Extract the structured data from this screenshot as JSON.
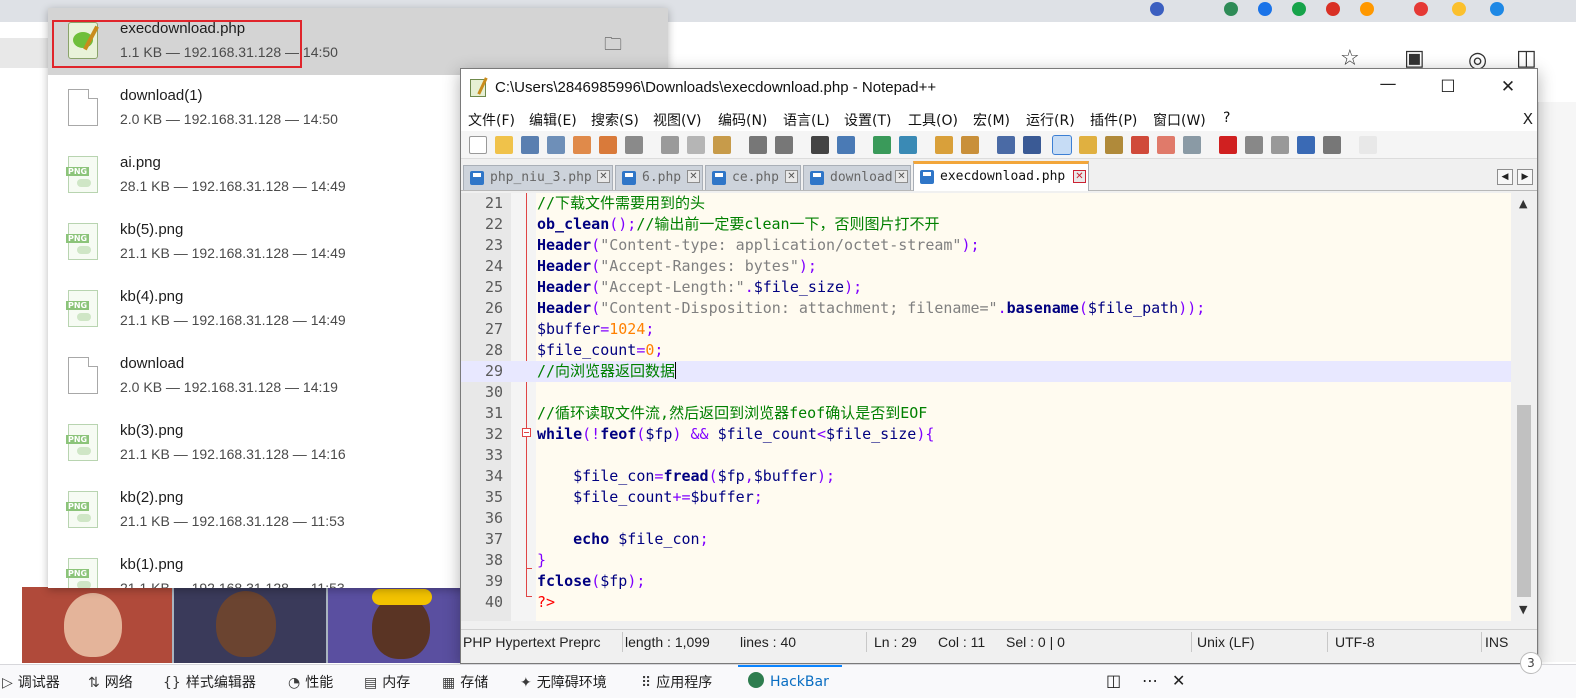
{
  "downloads": {
    "items": [
      {
        "name": "execdownload.php",
        "meta": "1.1 KB — 192.168.31.128 — 14:50",
        "type": "php"
      },
      {
        "name": "download(1)",
        "meta": "2.0 KB — 192.168.31.128 — 14:50",
        "type": "doc"
      },
      {
        "name": "ai.png",
        "meta": "28.1 KB — 192.168.31.128 — 14:49",
        "type": "png"
      },
      {
        "name": "kb(5).png",
        "meta": "21.1 KB — 192.168.31.128 — 14:49",
        "type": "png"
      },
      {
        "name": "kb(4).png",
        "meta": "21.1 KB — 192.168.31.128 — 14:49",
        "type": "png"
      },
      {
        "name": "download",
        "meta": "2.0 KB — 192.168.31.128 — 14:19",
        "type": "doc"
      },
      {
        "name": "kb(3).png",
        "meta": "21.1 KB — 192.168.31.128 — 14:16",
        "type": "png"
      },
      {
        "name": "kb(2).png",
        "meta": "21.1 KB — 192.168.31.128 — 11:53",
        "type": "png"
      },
      {
        "name": "kb(1).png",
        "meta": "21.1 KB — 192.168.31.128 — 11:53",
        "type": "png"
      }
    ],
    "png_tag": "PNG"
  },
  "notepad": {
    "title": "C:\\Users\\2846985996\\Downloads\\execdownload.php - Notepad++",
    "menu": [
      "文件(F)",
      "编辑(E)",
      "搜索(S)",
      "视图(V)",
      "编码(N)",
      "语言(L)",
      "设置(T)",
      "工具(O)",
      "宏(M)",
      "运行(R)",
      "插件(P)",
      "窗口(W)",
      "?"
    ],
    "menu_close": "X",
    "tabs": [
      "php_niu_3.php",
      "6.php",
      "ce.php",
      "download",
      "execdownload.php"
    ],
    "active_tab": "execdownload.php",
    "line_numbers": [
      "21",
      "22",
      "23",
      "24",
      "25",
      "26",
      "27",
      "28",
      "29",
      "30",
      "31",
      "32",
      "33",
      "34",
      "35",
      "36",
      "37",
      "38",
      "39",
      "40"
    ],
    "code_lines": [
      "//下载文件需要用到的头",
      "ob_clean();//输出前一定要clean一下，否则图片打不开",
      "Header(\"Content-type: application/octet-stream\");",
      "Header(\"Accept-Ranges: bytes\");",
      "Header(\"Accept-Length:\".$file_size);",
      "Header(\"Content-Disposition: attachment; filename=\".basename($file_path));",
      "$buffer=1024;",
      "$file_count=0;",
      "//向浏览器返回数据",
      "",
      "//循环读取文件流,然后返回到浏览器feof确认是否到EOF",
      "while(!feof($fp) && $file_count<$file_size){",
      "",
      "    $file_con=fread($fp,$buffer);",
      "    $file_count+=$buffer;",
      "",
      "    echo $file_con;",
      "}",
      "fclose($fp);",
      "?>"
    ],
    "current_line": "29",
    "status": {
      "language": "PHP Hypertext Preprc",
      "length": "length : 1,099",
      "lines": "lines : 40",
      "ln": "Ln : 29",
      "col": "Col : 11",
      "sel": "Sel : 0 | 0",
      "eol": "Unix (LF)",
      "encoding": "UTF-8",
      "mode": "INS"
    }
  },
  "devtools": {
    "tabs": [
      {
        "label": "调试器",
        "icon": "debugger-icon"
      },
      {
        "label": "网络",
        "icon": "network-icon"
      },
      {
        "label": "样式编辑器",
        "icon": "style-editor-icon"
      },
      {
        "label": "性能",
        "icon": "performance-icon"
      },
      {
        "label": "内存",
        "icon": "memory-icon"
      },
      {
        "label": "存储",
        "icon": "storage-icon"
      },
      {
        "label": "无障碍环境",
        "icon": "accessibility-icon"
      },
      {
        "label": "应用程序",
        "icon": "application-icon"
      },
      {
        "label": "HackBar",
        "icon": "hackbar-icon"
      }
    ],
    "active": "HackBar"
  },
  "badge": "3",
  "colors": {
    "highlight_box": "#e0252b",
    "active_tab_accent": "#f2a63a",
    "comment": "#008000",
    "keyword": "#000080",
    "string": "#808080",
    "number": "#ff8000",
    "operator": "#8000ff",
    "php_tag": "#ff0000",
    "devtools_active": "#0a6ec2"
  }
}
